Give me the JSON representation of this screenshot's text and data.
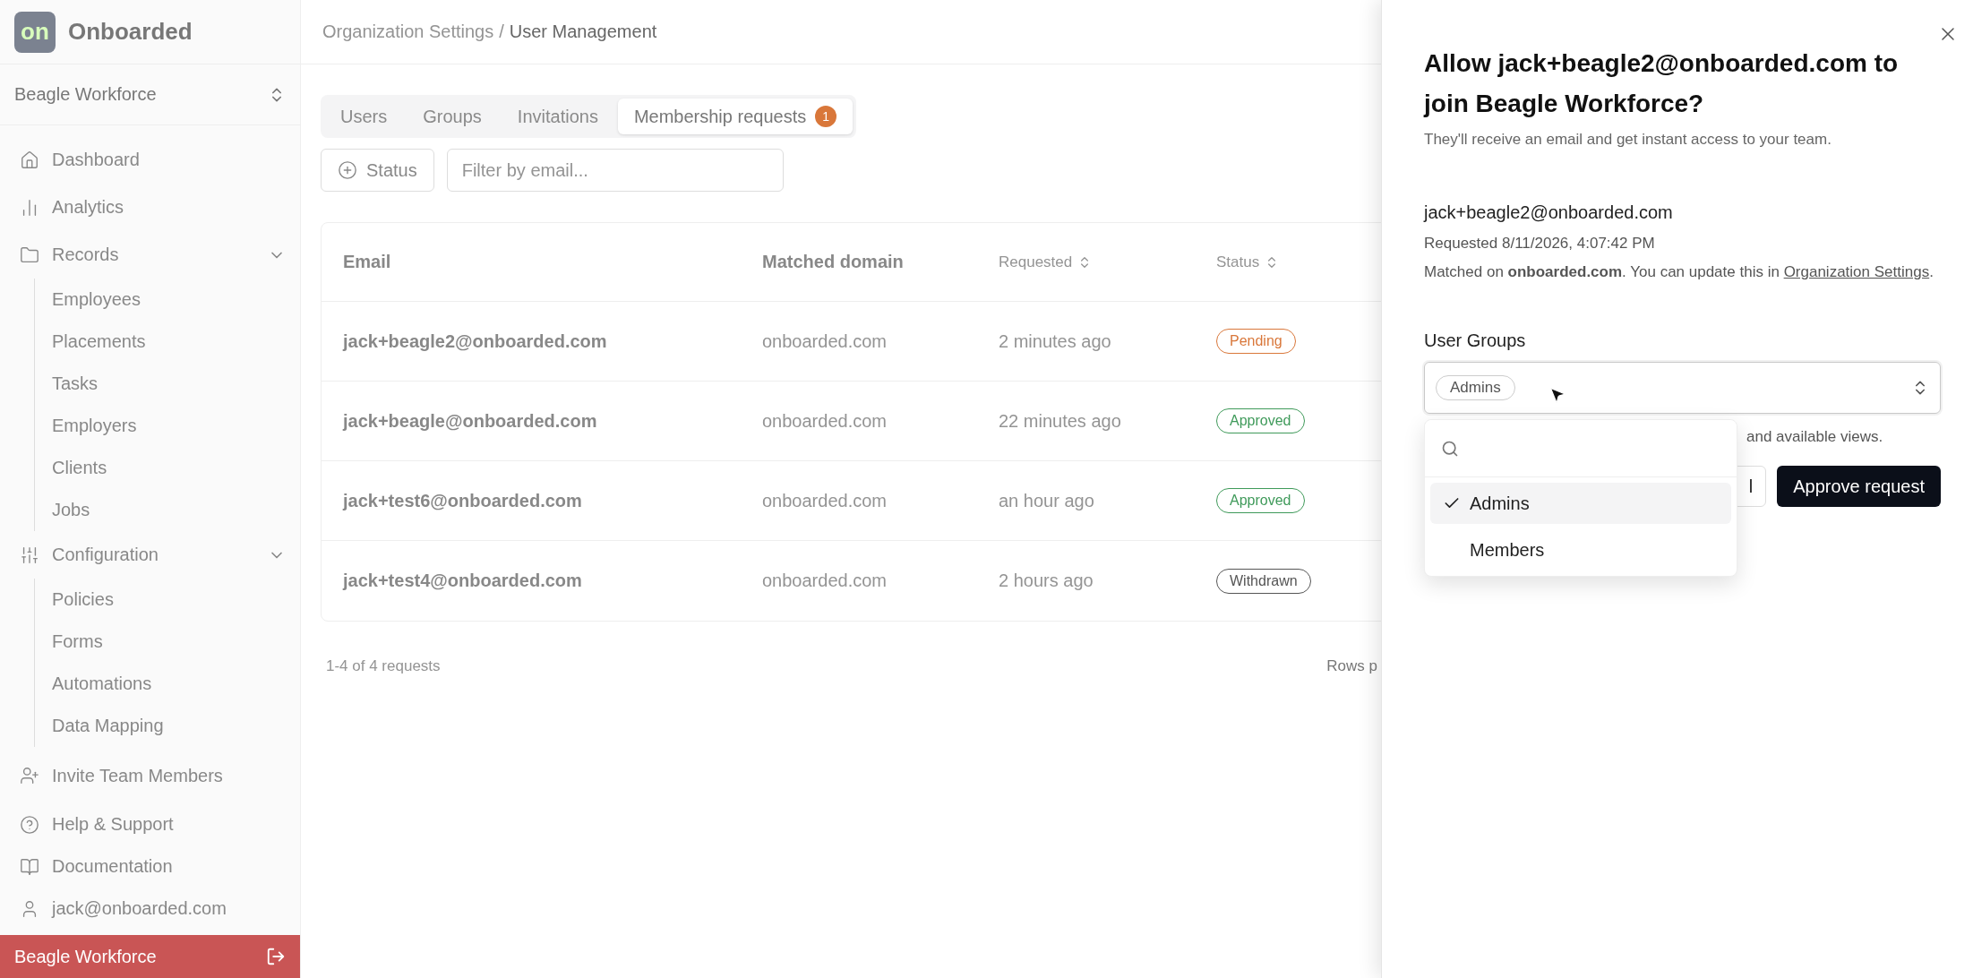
{
  "app": {
    "logo_mark": "on",
    "name": "Onboarded"
  },
  "workspace": {
    "name": "Beagle Workforce"
  },
  "sidebar": {
    "items": [
      {
        "label": "Dashboard"
      },
      {
        "label": "Analytics"
      },
      {
        "label": "Records",
        "expanded": true,
        "children": [
          {
            "label": "Employees"
          },
          {
            "label": "Placements"
          },
          {
            "label": "Tasks"
          },
          {
            "label": "Employers"
          },
          {
            "label": "Clients"
          },
          {
            "label": "Jobs"
          }
        ]
      },
      {
        "label": "Configuration",
        "expanded": true,
        "children": [
          {
            "label": "Policies"
          },
          {
            "label": "Forms"
          },
          {
            "label": "Automations"
          },
          {
            "label": "Data Mapping"
          }
        ]
      }
    ],
    "footer_items": [
      {
        "label": "Invite Team Members"
      },
      {
        "label": "Help & Support"
      },
      {
        "label": "Documentation"
      },
      {
        "label": "jack@onboarded.com"
      }
    ],
    "org_bar": {
      "label": "Beagle Workforce"
    }
  },
  "breadcrumb": [
    {
      "label": "Organization Settings",
      "current": false
    },
    {
      "label": "User Management",
      "current": true
    }
  ],
  "breadcrumb_separator": "/",
  "tabs": [
    {
      "label": "Users",
      "selected": false
    },
    {
      "label": "Groups",
      "selected": false
    },
    {
      "label": "Invitations",
      "selected": false
    },
    {
      "label": "Membership requests",
      "selected": true,
      "badge": "1"
    }
  ],
  "filters": {
    "status_button": "Status",
    "email_placeholder": "Filter by email..."
  },
  "table": {
    "columns": [
      {
        "label": "Email",
        "sortable": false
      },
      {
        "label": "Matched domain",
        "sortable": false
      },
      {
        "label": "Requested",
        "sortable": true
      },
      {
        "label": "Status",
        "sortable": true
      }
    ],
    "rows": [
      {
        "email": "jack+beagle2@onboarded.com",
        "domain": "onboarded.com",
        "requested": "2 minutes ago",
        "status": "Pending",
        "color": "#d9773a"
      },
      {
        "email": "jack+beagle@onboarded.com",
        "domain": "onboarded.com",
        "requested": "22 minutes ago",
        "status": "Approved",
        "color": "#3f9a5a"
      },
      {
        "email": "jack+test6@onboarded.com",
        "domain": "onboarded.com",
        "requested": "an hour ago",
        "status": "Approved",
        "color": "#3f9a5a"
      },
      {
        "email": "jack+test4@onboarded.com",
        "domain": "onboarded.com",
        "requested": "2 hours ago",
        "status": "Withdrawn",
        "color": "#555555"
      }
    ],
    "footer": {
      "count": "1-4 of 4 requests",
      "rows_per_page": "Rows p"
    }
  },
  "sheet": {
    "title": "Allow jack+beagle2@onboarded.com to join Beagle Workforce?",
    "subtitle": "They'll receive an email and get instant access to your team.",
    "email": "jack+beagle2@onboarded.com",
    "requested": "Requested 8/11/2026, 4:07:42 PM",
    "matched": {
      "before": "Matched on **onboarded.com**. You can update this in ",
      "link": "Organization Settings",
      "after": "."
    },
    "groups_label": "User Groups",
    "selected_tags": [
      "Admins"
    ],
    "helper": "and available views.",
    "cancel": "l",
    "approve": "Approve request",
    "dropdown": {
      "open": true,
      "options": [
        {
          "label": "Admins",
          "selected": true
        },
        {
          "label": "Members",
          "selected": false
        }
      ]
    }
  }
}
